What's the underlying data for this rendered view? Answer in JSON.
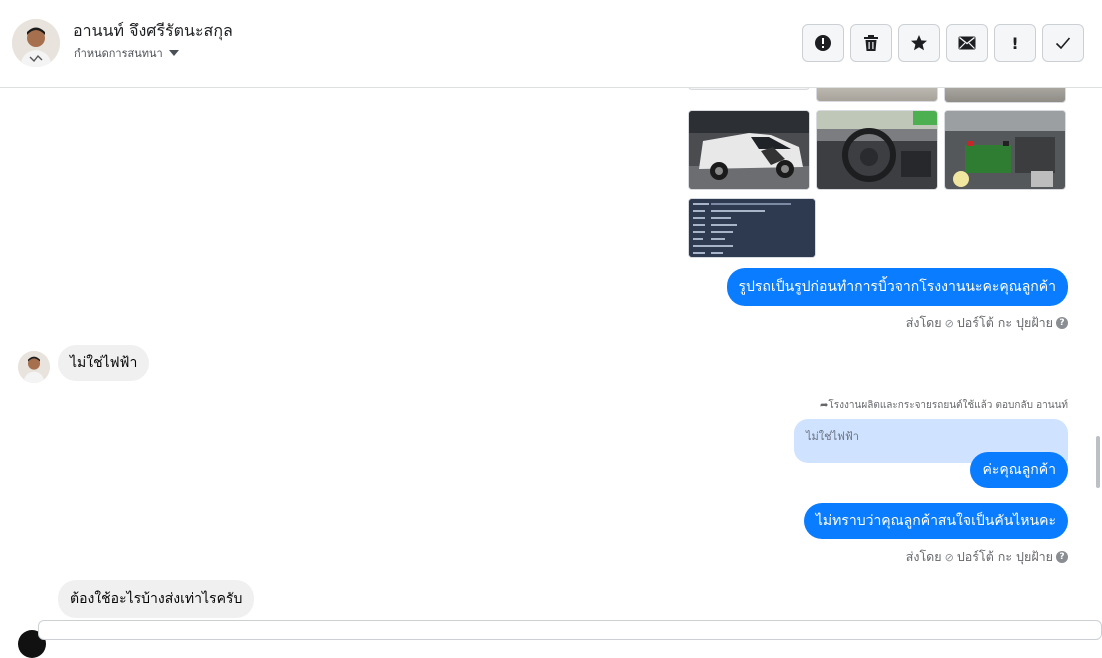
{
  "header": {
    "contact_name": "อานนท์ จึงศรีรัตนะสกุล",
    "assign_label": "กำหนดการสนทนา",
    "actions": [
      {
        "name": "report-button",
        "icon": "alert-circle-icon"
      },
      {
        "name": "delete-button",
        "icon": "trash-icon"
      },
      {
        "name": "star-button",
        "icon": "star-icon"
      },
      {
        "name": "mark-unread-button",
        "icon": "envelope-icon"
      },
      {
        "name": "spam-button",
        "icon": "exclamation-icon",
        "glyph": "!"
      },
      {
        "name": "done-button",
        "icon": "checkmark-icon"
      }
    ]
  },
  "messages": {
    "out_photos_caption": "รูปรถเป็นรูปก่อนทำการบิ้วจากโรงงานนะคะคุณลูกค้า",
    "sent_by_1": {
      "prefix": "ส่งโดย",
      "name": "ปอร์โต้ กะ ปุยฝ้าย"
    },
    "in_not_electric": "ไม่ใช่ไฟฟ้า",
    "reply_note": "โรงงานผลิตและกระจายรถยนต์ใช้แล้ว ตอบกลับ อานนท์",
    "quoted_text": "ไม่ใช่ไฟฟ้า",
    "out_ka": "ค่ะคุณลูกค้า",
    "out_which_car": "ไม่ทราบว่าคุณลูกค้าสนใจเป็นคันไหนคะ",
    "sent_by_2": {
      "prefix": "ส่งโดย",
      "name": "ปอร์โต้ กะ ปุยฝ้าย"
    },
    "in_what_needed": "ต้องใช้อะไรบ้างส่งเท่าไรครับ"
  },
  "colors": {
    "outgoing_bubble": "#0a7cff",
    "incoming_bubble": "#f0f0f0",
    "quote_bubble": "#cfe2ff"
  }
}
